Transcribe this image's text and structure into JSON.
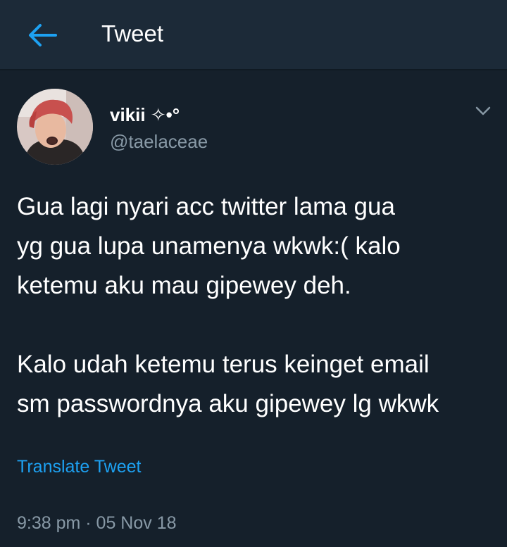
{
  "header": {
    "title": "Tweet",
    "back_icon": "arrow-left-icon"
  },
  "tweet": {
    "author": {
      "display_name": "vikii ✧•°",
      "handle": "@taelaceae",
      "avatar": "profile-photo"
    },
    "menu_icon": "chevron-down-icon",
    "text_lines": [
      "Gua lagi nyari acc twitter lama gua",
      "yg gua lupa unamenya wkwk:( kalo",
      "ketemu aku mau gipewey deh.",
      "Kalo udah ketemu terus keinget email",
      "sm passwordnya aku gipewey lg wkwk"
    ],
    "translate_label": "Translate Tweet",
    "timestamp": "9:38 pm · 05 Nov 18"
  },
  "colors": {
    "background": "#15202b",
    "header": "#1c2a38",
    "accent": "#1da1f2",
    "secondary_text": "#8899a6"
  }
}
